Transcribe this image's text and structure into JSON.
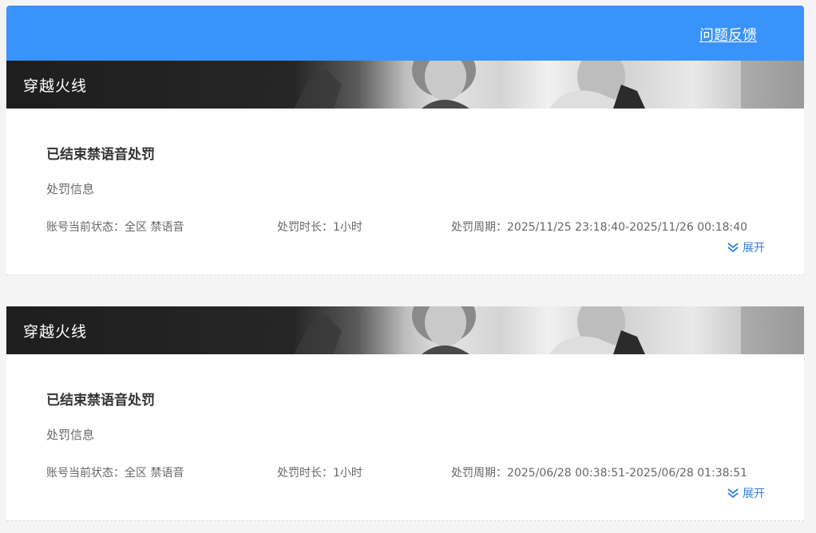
{
  "header": {
    "feedback_label": "问题反馈",
    "background_color": "#3a93fb"
  },
  "records": [
    {
      "game_title": "穿越火线",
      "status_title": "已结束禁语音处罚",
      "section_label": "处罚信息",
      "account_status": "账号当前状态：全区 禁语音",
      "duration": "处罚时长：1小时",
      "period": "处罚周期：2025/11/25 23:18:40-2025/11/26 00:18:40",
      "expand_label": "展开",
      "expand_icon": "double-chevron-down-icon"
    },
    {
      "game_title": "穿越火线",
      "status_title": "已结束禁语音处罚",
      "section_label": "处罚信息",
      "account_status": "账号当前状态：全区 禁语音",
      "duration": "处罚时长：1小时",
      "period": "处罚周期：2025/06/28 00:38:51-2025/06/28 01:38:51",
      "expand_label": "展开",
      "expand_icon": "double-chevron-down-icon"
    }
  ]
}
